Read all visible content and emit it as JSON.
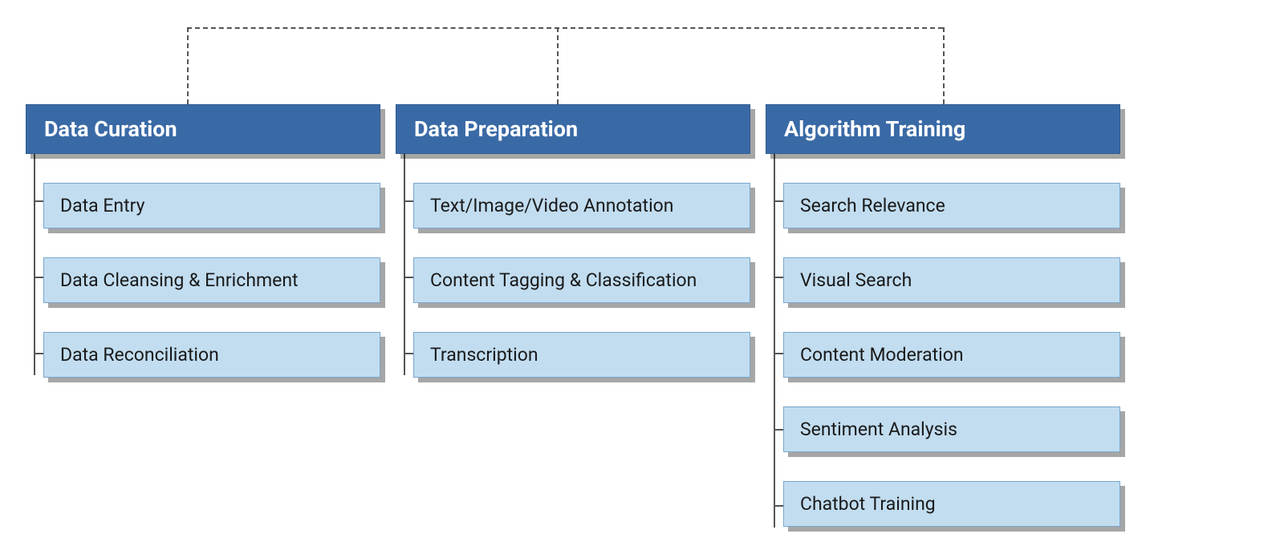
{
  "columns": [
    {
      "title": "Data Curation",
      "items": [
        "Data Entry",
        "Data Cleansing & Enrichment",
        "Data Reconciliation"
      ]
    },
    {
      "title": "Data Preparation",
      "items": [
        "Text/Image/Video Annotation",
        "Content Tagging & Classification",
        "Transcription"
      ]
    },
    {
      "title": "Algorithm Training",
      "items": [
        "Search Relevance",
        "Visual Search",
        "Content Moderation",
        "Sentiment Analysis",
        "Chatbot Training"
      ]
    }
  ],
  "colors": {
    "header_bg": "#3a6aa6",
    "header_fg": "#ffffff",
    "item_bg": "#c2ddf0",
    "item_fg": "#1a1a1a",
    "connector": "#555555"
  }
}
